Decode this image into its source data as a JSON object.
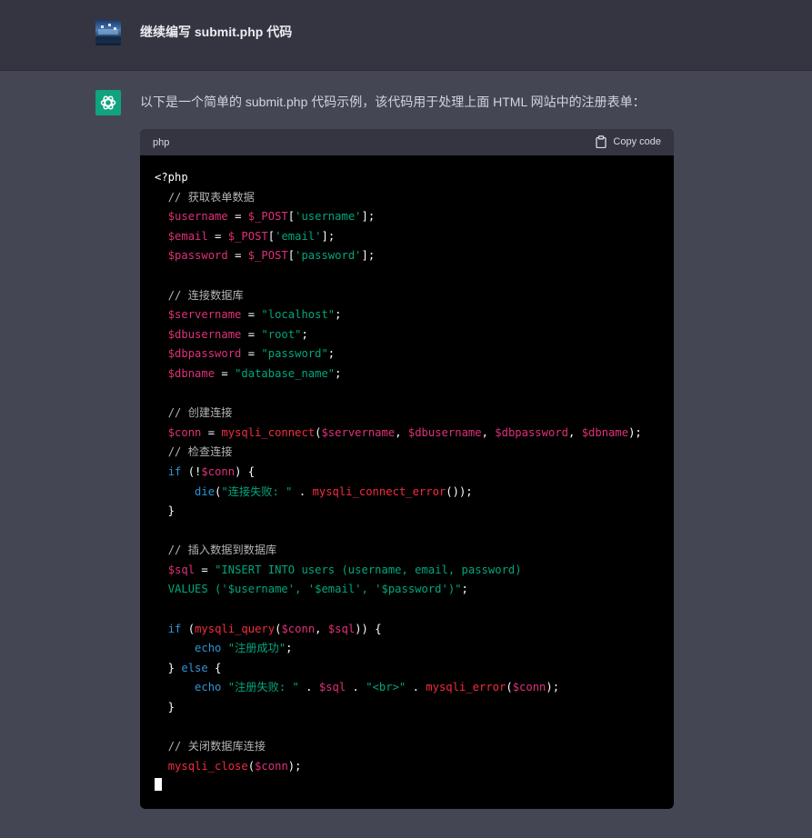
{
  "user_message": "继续编写 submit.php 代码",
  "assistant_message": "以下是一个简单的 submit.php 代码示例，该代码用于处理上面 HTML 网站中的注册表单：",
  "code_block": {
    "language": "php",
    "copy_label": "Copy code",
    "lines": [
      [
        [
          "t-op",
          "<?php"
        ]
      ],
      [
        [
          "t-op",
          "  "
        ],
        [
          "t-com",
          "// 获取表单数据"
        ]
      ],
      [
        [
          "t-op",
          "  "
        ],
        [
          "t-var",
          "$username"
        ],
        [
          "t-op",
          " = "
        ],
        [
          "t-var",
          "$_POST"
        ],
        [
          "t-op",
          "["
        ],
        [
          "t-str",
          "'username'"
        ],
        [
          "t-op",
          "];"
        ]
      ],
      [
        [
          "t-op",
          "  "
        ],
        [
          "t-var",
          "$email"
        ],
        [
          "t-op",
          " = "
        ],
        [
          "t-var",
          "$_POST"
        ],
        [
          "t-op",
          "["
        ],
        [
          "t-str",
          "'email'"
        ],
        [
          "t-op",
          "];"
        ]
      ],
      [
        [
          "t-op",
          "  "
        ],
        [
          "t-var",
          "$password"
        ],
        [
          "t-op",
          " = "
        ],
        [
          "t-var",
          "$_POST"
        ],
        [
          "t-op",
          "["
        ],
        [
          "t-str",
          "'password'"
        ],
        [
          "t-op",
          "];"
        ]
      ],
      [],
      [
        [
          "t-op",
          "  "
        ],
        [
          "t-com",
          "// 连接数据库"
        ]
      ],
      [
        [
          "t-op",
          "  "
        ],
        [
          "t-var",
          "$servername"
        ],
        [
          "t-op",
          " = "
        ],
        [
          "t-str",
          "\"localhost\""
        ],
        [
          "t-op",
          ";"
        ]
      ],
      [
        [
          "t-op",
          "  "
        ],
        [
          "t-var",
          "$dbusername"
        ],
        [
          "t-op",
          " = "
        ],
        [
          "t-str",
          "\"root\""
        ],
        [
          "t-op",
          ";"
        ]
      ],
      [
        [
          "t-op",
          "  "
        ],
        [
          "t-var",
          "$dbpassword"
        ],
        [
          "t-op",
          " = "
        ],
        [
          "t-str",
          "\"password\""
        ],
        [
          "t-op",
          ";"
        ]
      ],
      [
        [
          "t-op",
          "  "
        ],
        [
          "t-var",
          "$dbname"
        ],
        [
          "t-op",
          " = "
        ],
        [
          "t-str",
          "\"database_name\""
        ],
        [
          "t-op",
          ";"
        ]
      ],
      [],
      [
        [
          "t-op",
          "  "
        ],
        [
          "t-com",
          "// 创建连接"
        ]
      ],
      [
        [
          "t-op",
          "  "
        ],
        [
          "t-var",
          "$conn"
        ],
        [
          "t-op",
          " = "
        ],
        [
          "t-fn",
          "mysqli_connect"
        ],
        [
          "t-op",
          "("
        ],
        [
          "t-var",
          "$servername"
        ],
        [
          "t-op",
          ", "
        ],
        [
          "t-var",
          "$dbusername"
        ],
        [
          "t-op",
          ", "
        ],
        [
          "t-var",
          "$dbpassword"
        ],
        [
          "t-op",
          ", "
        ],
        [
          "t-var",
          "$dbname"
        ],
        [
          "t-op",
          ");"
        ]
      ],
      [
        [
          "t-op",
          "  "
        ],
        [
          "t-com",
          "// 检查连接"
        ]
      ],
      [
        [
          "t-op",
          "  "
        ],
        [
          "t-kw",
          "if"
        ],
        [
          "t-op",
          " (!"
        ],
        [
          "t-var",
          "$conn"
        ],
        [
          "t-op",
          ") {"
        ]
      ],
      [
        [
          "t-op",
          "      "
        ],
        [
          "t-kw",
          "die"
        ],
        [
          "t-op",
          "("
        ],
        [
          "t-str",
          "\"连接失败: \""
        ],
        [
          "t-op",
          " . "
        ],
        [
          "t-fn",
          "mysqli_connect_error"
        ],
        [
          "t-op",
          "());"
        ]
      ],
      [
        [
          "t-op",
          "  }"
        ]
      ],
      [],
      [
        [
          "t-op",
          "  "
        ],
        [
          "t-com",
          "// 插入数据到数据库"
        ]
      ],
      [
        [
          "t-op",
          "  "
        ],
        [
          "t-var",
          "$sql"
        ],
        [
          "t-op",
          " = "
        ],
        [
          "t-str",
          "\"INSERT INTO users (username, email, password)"
        ]
      ],
      [
        [
          "t-op",
          "  "
        ],
        [
          "t-str",
          "VALUES ('$username', '$email', '$password')\""
        ],
        [
          "t-op",
          ";"
        ]
      ],
      [],
      [
        [
          "t-op",
          "  "
        ],
        [
          "t-kw",
          "if"
        ],
        [
          "t-op",
          " ("
        ],
        [
          "t-fn",
          "mysqli_query"
        ],
        [
          "t-op",
          "("
        ],
        [
          "t-var",
          "$conn"
        ],
        [
          "t-op",
          ", "
        ],
        [
          "t-var",
          "$sql"
        ],
        [
          "t-op",
          ")) {"
        ]
      ],
      [
        [
          "t-op",
          "      "
        ],
        [
          "t-kw",
          "echo"
        ],
        [
          "t-op",
          " "
        ],
        [
          "t-str",
          "\"注册成功\""
        ],
        [
          "t-op",
          ";"
        ]
      ],
      [
        [
          "t-op",
          "  } "
        ],
        [
          "t-kw",
          "else"
        ],
        [
          "t-op",
          " {"
        ]
      ],
      [
        [
          "t-op",
          "      "
        ],
        [
          "t-kw",
          "echo"
        ],
        [
          "t-op",
          " "
        ],
        [
          "t-str",
          "\"注册失败: \""
        ],
        [
          "t-op",
          " . "
        ],
        [
          "t-var",
          "$sql"
        ],
        [
          "t-op",
          " . "
        ],
        [
          "t-str",
          "\"<br>\""
        ],
        [
          "t-op",
          " . "
        ],
        [
          "t-fn",
          "mysqli_error"
        ],
        [
          "t-op",
          "("
        ],
        [
          "t-var",
          "$conn"
        ],
        [
          "t-op",
          ");"
        ]
      ],
      [
        [
          "t-op",
          "  }"
        ]
      ],
      [],
      [
        [
          "t-op",
          "  "
        ],
        [
          "t-com",
          "// 关闭数据库连接"
        ]
      ],
      [
        [
          "t-op",
          "  "
        ],
        [
          "t-fn",
          "mysqli_close"
        ],
        [
          "t-op",
          "("
        ],
        [
          "t-var",
          "$conn"
        ],
        [
          "t-op",
          ");"
        ]
      ]
    ]
  }
}
